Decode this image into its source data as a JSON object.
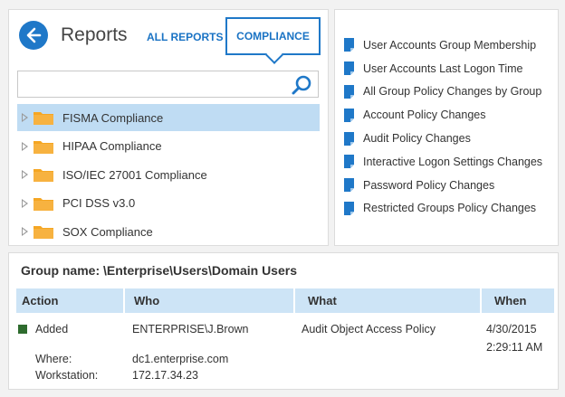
{
  "header": {
    "title": "Reports",
    "nav_all": "ALL REPORTS",
    "nav_compliance": "COMPLIANCE"
  },
  "search": {
    "placeholder": "",
    "value": ""
  },
  "tree": [
    {
      "label": "FISMA Compliance",
      "selected": true
    },
    {
      "label": "HIPAA Compliance",
      "selected": false
    },
    {
      "label": "ISO/IEC 27001 Compliance",
      "selected": false
    },
    {
      "label": "PCI DSS v3.0",
      "selected": false
    },
    {
      "label": "SOX Compliance",
      "selected": false
    }
  ],
  "reports": [
    "User Accounts Group Membership",
    "User Accounts Last Logon Time",
    "All Group Policy Changes by Group",
    "Account Policy Changes",
    "Audit Policy Changes",
    "Interactive Logon Settings Changes",
    "Password Policy Changes",
    "Restricted Groups Policy Changes"
  ],
  "detail": {
    "group_title": "Group name: \\Enterprise\\Users\\Domain Users",
    "columns": {
      "action": "Action",
      "who": "Who",
      "what": "What",
      "when": "When"
    },
    "row": {
      "action": "Added",
      "who": "ENTERPRISE\\J.Brown",
      "what": "Audit Object Access Policy",
      "when_date": "4/30/2015",
      "when_time": "2:29:11 AM",
      "where_label": "Where:",
      "where_value": "dc1.enterprise.com",
      "workstation_label": "Workstation:",
      "workstation_value": "172.17.34.23"
    }
  },
  "colors": {
    "accent": "#1f78c8",
    "selected_row": "#bfdcf3",
    "table_header": "#cde4f6",
    "folder": "#f5a623",
    "status_added": "#2e6b2e"
  }
}
